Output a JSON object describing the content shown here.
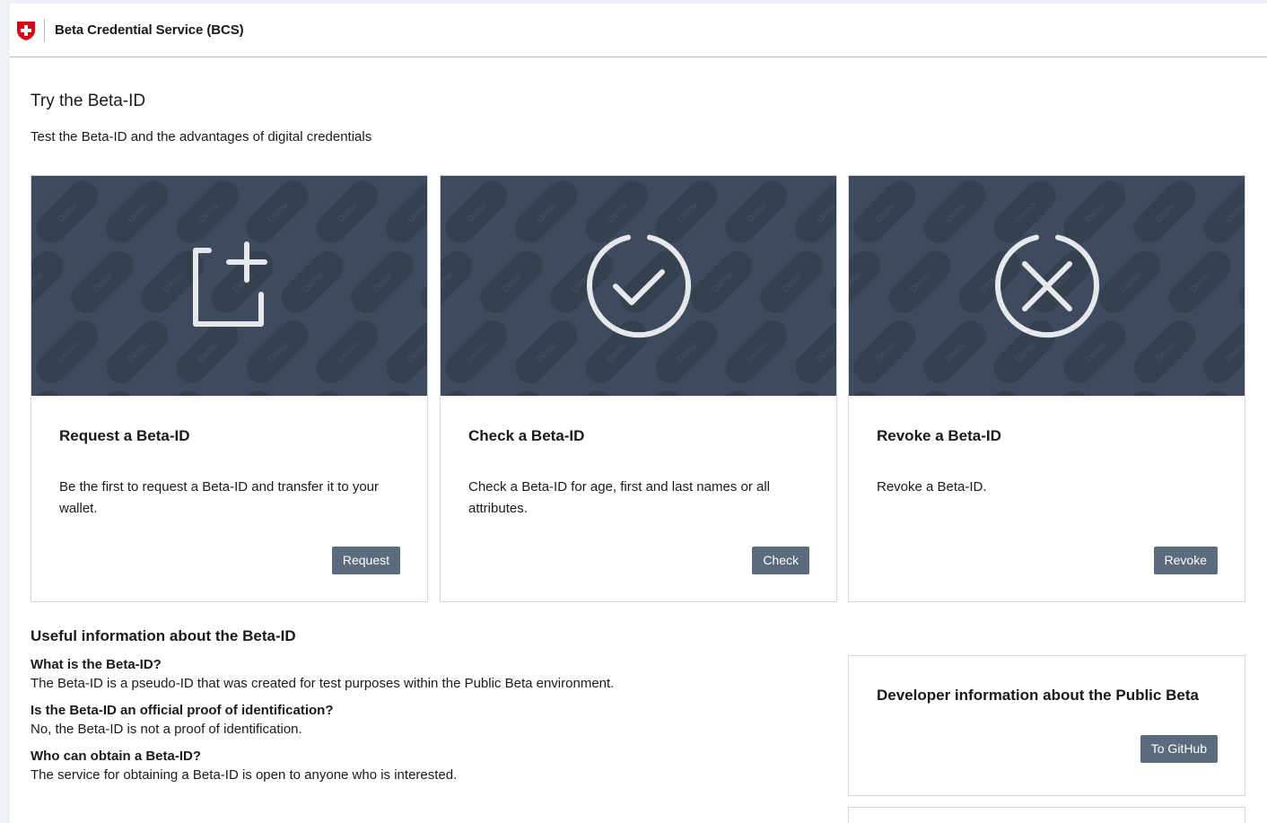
{
  "header": {
    "service_name": "Beta Credential Service (BCS)"
  },
  "intro": {
    "title": "Try the Beta-ID",
    "subtitle": "Test the Beta-ID and the advantages of digital credentials"
  },
  "cards": [
    {
      "title": "Request a Beta-ID",
      "text": "Be the first to request a Beta-ID and transfer it to your wallet.",
      "button": "Request",
      "icon": "add-document-icon"
    },
    {
      "title": "Check a Beta-ID",
      "text": "Check a Beta-ID for age, first and last names or all attributes.",
      "button": "Check",
      "icon": "check-circle-icon"
    },
    {
      "title": "Revoke a Beta-ID",
      "text": "Revoke a Beta-ID.",
      "button": "Revoke",
      "icon": "x-circle-icon"
    }
  ],
  "banner_watermark": "Demo",
  "info": {
    "title": "Useful information about the Beta-ID",
    "faqs": [
      {
        "q": "What is the Beta-ID?",
        "a": "The Beta-ID is a pseudo-ID that was created for test purposes within the Public Beta environment."
      },
      {
        "q": "Is the Beta-ID an official proof of identification?",
        "a": "No, the Beta-ID is not a proof of identification."
      },
      {
        "q": "Who can obtain a Beta-ID?",
        "a": "The service for obtaining a Beta-ID is open to anyone who is interested."
      }
    ]
  },
  "developer": {
    "title": "Developer information about the Public Beta",
    "button": "To GitHub"
  },
  "colors": {
    "banner": "#3e4b5e",
    "button": "#5a6b7d",
    "swiss_red": "#dc0018"
  }
}
